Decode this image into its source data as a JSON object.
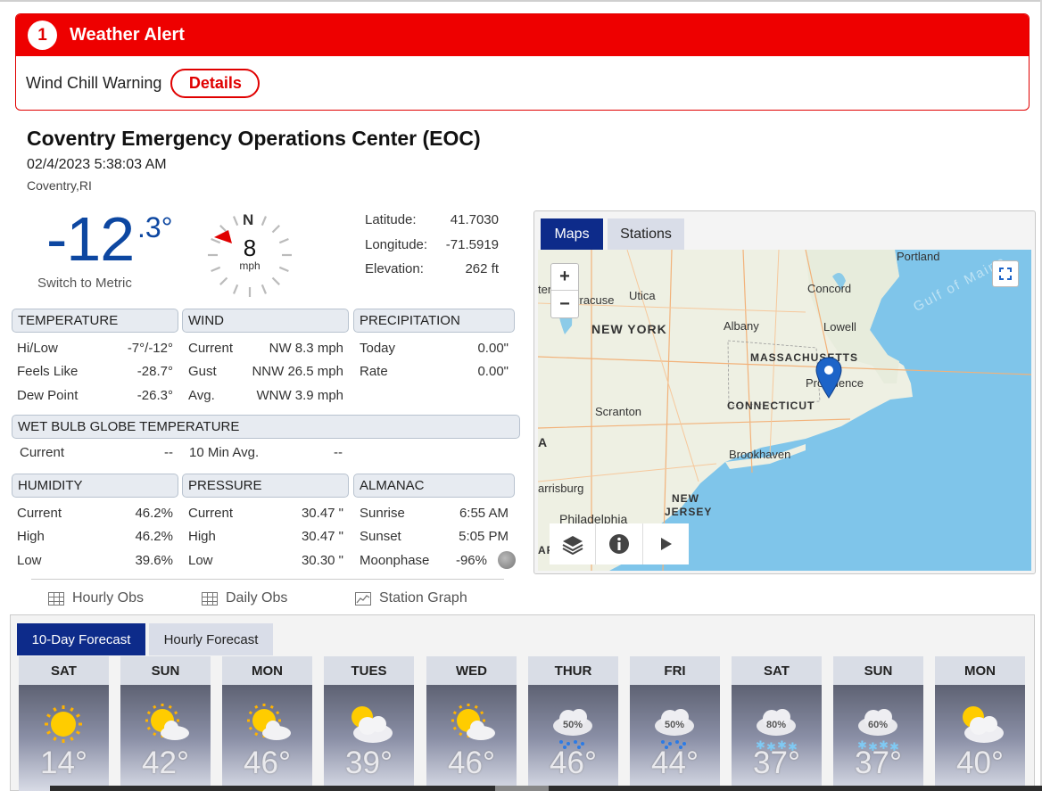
{
  "alert": {
    "count": "1",
    "title": "Weather Alert",
    "text": "Wind Chill Warning",
    "details_label": "Details"
  },
  "station": {
    "name": "Coventry Emergency Operations Center (EOC)",
    "timestamp": "02/4/2023 5:38:03 AM",
    "location": "Coventry,RI"
  },
  "current": {
    "temp_int": "-12",
    "temp_dec": ".3°",
    "switch_label": "Switch to Metric"
  },
  "wind_dial": {
    "dir_label": "N",
    "speed": "8",
    "unit": "mph"
  },
  "coords": {
    "lat_label": "Latitude:",
    "lat": "41.7030",
    "lon_label": "Longitude:",
    "lon": "-71.5919",
    "elev_label": "Elevation:",
    "elev": "262 ft"
  },
  "temperature": {
    "title": "TEMPERATURE",
    "rows": [
      {
        "label": "Hi/Low",
        "value": "-7°/-12°"
      },
      {
        "label": "Feels Like",
        "value": "-28.7°"
      },
      {
        "label": "Dew Point",
        "value": "-26.3°"
      }
    ]
  },
  "wind": {
    "title": "WIND",
    "rows": [
      {
        "label": "Current",
        "value": "NW 8.3 mph"
      },
      {
        "label": "Gust",
        "value": "NNW 26.5 mph"
      },
      {
        "label": "Avg.",
        "value": "WNW 3.9 mph"
      }
    ]
  },
  "precipitation": {
    "title": "PRECIPITATION",
    "rows": [
      {
        "label": "Today",
        "value": "0.00\""
      },
      {
        "label": "Rate",
        "value": "0.00\""
      }
    ]
  },
  "wbgt": {
    "title": "WET BULB GLOBE TEMPERATURE",
    "current_label": "Current",
    "current_value": "--",
    "avg_label": "10 Min Avg.",
    "avg_value": "--"
  },
  "humidity": {
    "title": "HUMIDITY",
    "rows": [
      {
        "label": "Current",
        "value": "46.2%"
      },
      {
        "label": "High",
        "value": "46.2%"
      },
      {
        "label": "Low",
        "value": "39.6%"
      }
    ]
  },
  "pressure": {
    "title": "PRESSURE",
    "rows": [
      {
        "label": "Current",
        "value": "30.47 \""
      },
      {
        "label": "High",
        "value": "30.47 \""
      },
      {
        "label": "Low",
        "value": "30.30 \""
      }
    ]
  },
  "almanac": {
    "title": "ALMANAC",
    "rows": [
      {
        "label": "Sunrise",
        "value": "6:55 AM"
      },
      {
        "label": "Sunset",
        "value": "5:05 PM"
      },
      {
        "label": "Moonphase",
        "value": "-96%"
      }
    ]
  },
  "links": {
    "hourly": "Hourly Obs",
    "daily": "Daily Obs",
    "graph": "Station Graph"
  },
  "map": {
    "tabs": [
      "Maps",
      "Stations"
    ],
    "zoom_in": "+",
    "zoom_out": "−",
    "labels": [
      "Portland",
      "Concord",
      "Utica",
      "yracuse",
      "Albany",
      "NEW YORK",
      "Lowell",
      "MASSACHUSETTS",
      "Providence",
      "CONNECTICUT",
      "Scranton",
      "Brookhaven",
      "arrisburg",
      "NEW",
      "JERSEY",
      "Philadelphia",
      "Gulf of Maine",
      "A",
      "AF",
      "ter"
    ]
  },
  "forecast": {
    "tabs": [
      "10-Day Forecast",
      "Hourly Forecast"
    ],
    "days": [
      {
        "day": "SAT",
        "temp": "14°",
        "icon": "sun-icon"
      },
      {
        "day": "SUN",
        "temp": "42°",
        "icon": "partly-cloudy-icon"
      },
      {
        "day": "MON",
        "temp": "46°",
        "icon": "partly-cloudy-icon"
      },
      {
        "day": "TUES",
        "temp": "39°",
        "icon": "mostly-cloudy-icon"
      },
      {
        "day": "WED",
        "temp": "46°",
        "icon": "partly-cloudy-icon"
      },
      {
        "day": "THUR",
        "temp": "46°",
        "icon": "rain-icon",
        "pop": "50%"
      },
      {
        "day": "FRI",
        "temp": "44°",
        "icon": "rain-icon",
        "pop": "50%"
      },
      {
        "day": "SAT",
        "temp": "37°",
        "icon": "snow-icon",
        "pop": "80%"
      },
      {
        "day": "SUN",
        "temp": "37°",
        "icon": "snow-icon",
        "pop": "60%"
      },
      {
        "day": "MON",
        "temp": "40°",
        "icon": "mostly-cloudy-icon"
      }
    ]
  },
  "colors": {
    "alert_red": "#ee0000",
    "temp_blue": "#0d47a1",
    "tab_active": "#0d2b8a"
  }
}
